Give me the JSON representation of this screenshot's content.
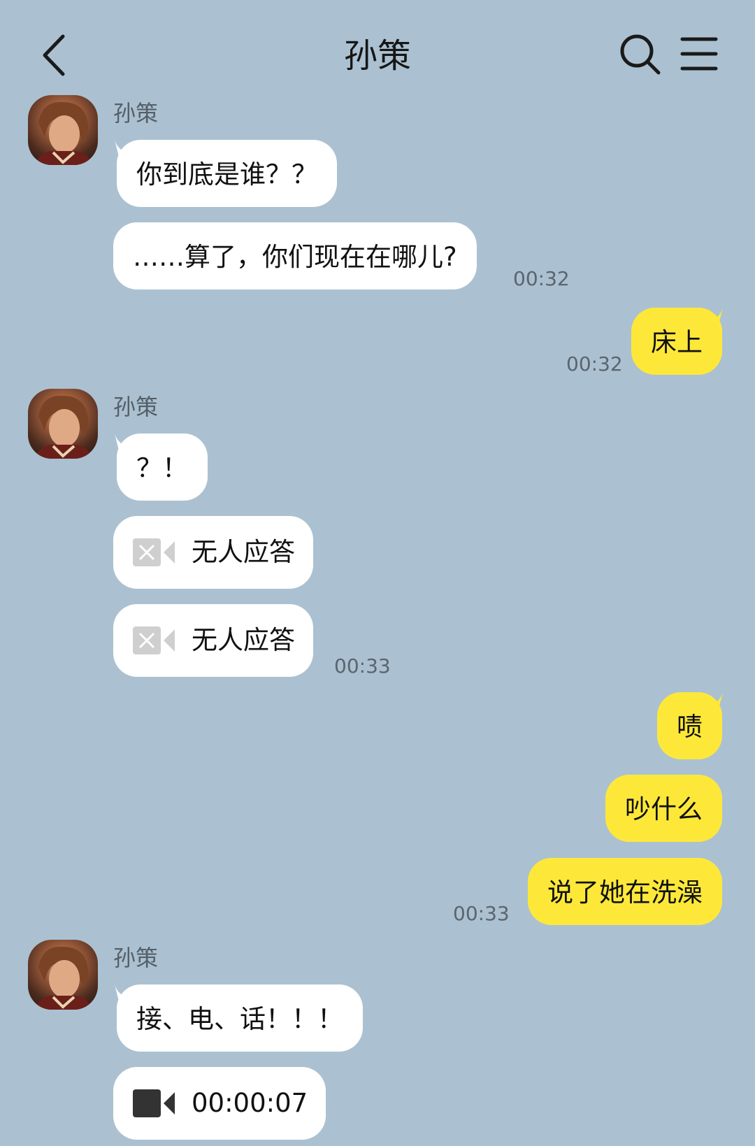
{
  "colors": {
    "background": "#abc1d1",
    "incoming_bubble": "#ffffff",
    "outgoing_bubble": "#fde83a"
  },
  "header": {
    "title": "孙策",
    "back_icon": "chevron-left-icon",
    "search_icon": "search-icon",
    "menu_icon": "hamburger-menu-icon"
  },
  "messages": [
    {
      "type": "sender",
      "name": "孙策"
    },
    {
      "type": "text",
      "direction": "in",
      "text": "你到底是谁？？"
    },
    {
      "type": "text",
      "direction": "in",
      "text": "……算了，你们现在在哪儿?",
      "time": "00:32"
    },
    {
      "type": "text",
      "direction": "out",
      "text": "床上",
      "time": "00:32"
    },
    {
      "type": "sender",
      "name": "孙策"
    },
    {
      "type": "text",
      "direction": "in",
      "text": "？！"
    },
    {
      "type": "call",
      "direction": "in",
      "status": "missed",
      "icon": "video-call-missed-icon",
      "text": "无人应答"
    },
    {
      "type": "call",
      "direction": "in",
      "status": "missed",
      "icon": "video-call-missed-icon",
      "text": "无人应答",
      "time": "00:33"
    },
    {
      "type": "text",
      "direction": "out",
      "text": "啧"
    },
    {
      "type": "text",
      "direction": "out",
      "text": "吵什么"
    },
    {
      "type": "text",
      "direction": "out",
      "text": "说了她在洗澡",
      "time": "00:33"
    },
    {
      "type": "sender",
      "name": "孙策"
    },
    {
      "type": "text",
      "direction": "in",
      "text": "接、电、话！！！"
    },
    {
      "type": "call",
      "direction": "in",
      "status": "completed",
      "icon": "video-call-icon",
      "text": "00:00:07"
    }
  ]
}
